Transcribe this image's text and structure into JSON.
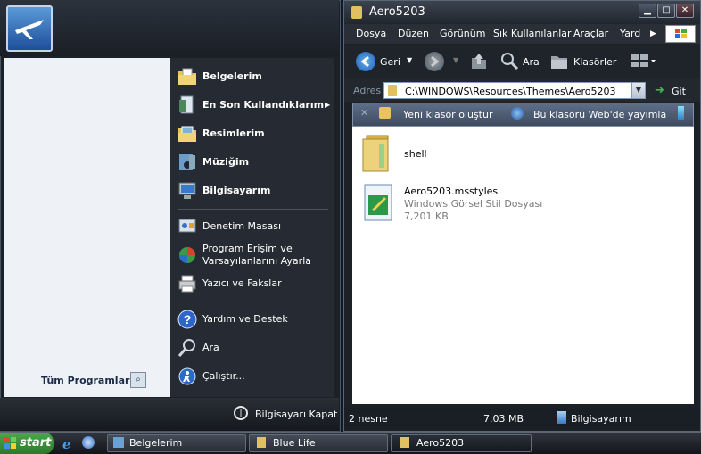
{
  "start_menu": {
    "all_programs": "Tüm Programlar",
    "items": [
      {
        "label": "Belgelerim",
        "icon": "folder-documents-icon",
        "bold": true
      },
      {
        "label": "En Son Kullandıklarım",
        "icon": "recent-documents-icon",
        "bold": true,
        "has_submenu": true
      },
      {
        "label": "Resimlerim",
        "icon": "folder-pictures-icon",
        "bold": true
      },
      {
        "label": "Müziğim",
        "icon": "folder-music-icon",
        "bold": true
      },
      {
        "label": "Bilgisayarım",
        "icon": "my-computer-icon",
        "bold": true
      },
      {
        "label": "Denetim Masası",
        "icon": "control-panel-icon"
      },
      {
        "label": "Program Erişim ve",
        "label2": "Varsayılanlarını Ayarla",
        "icon": "program-defaults-icon"
      },
      {
        "label": "Yazıcı ve Fakslar",
        "icon": "printer-icon"
      },
      {
        "label": "Yardım ve Destek",
        "icon": "help-icon"
      },
      {
        "label": "Ara",
        "icon": "search-icon"
      },
      {
        "label": "Çalıştır...",
        "icon": "run-icon"
      }
    ],
    "shutdown": "Bilgisayarı Kapat"
  },
  "explorer": {
    "title": "Aero5203",
    "menu": [
      "Dosya",
      "Düzen",
      "Görünüm",
      "Sık Kullanılanlar",
      "Araçlar",
      "Yard"
    ],
    "toolbar": {
      "back": "Geri",
      "search": "Ara",
      "folders": "Klasörler"
    },
    "address_label": "Adres",
    "address_value": "C:\\WINDOWS\\Resources\\Themes\\Aero5203",
    "go_label": "Git",
    "tasks": {
      "new_folder": "Yeni klasör oluştur",
      "publish": "Bu klasörü Web'de yayımla"
    },
    "files": [
      {
        "name": "shell",
        "icon": "folder-icon"
      },
      {
        "name": "Aero5203.msstyles",
        "type": "Windows Görsel Stil Dosyası",
        "size": "7,201 KB",
        "icon": "msstyles-file-icon"
      }
    ],
    "status": {
      "count": "2 nesne",
      "size": "7.03 MB",
      "location": "Bilgisayarım"
    }
  },
  "taskbar": {
    "start": "start",
    "buttons": [
      "Belgelerim",
      "Blue Life",
      "Aero5203"
    ]
  }
}
